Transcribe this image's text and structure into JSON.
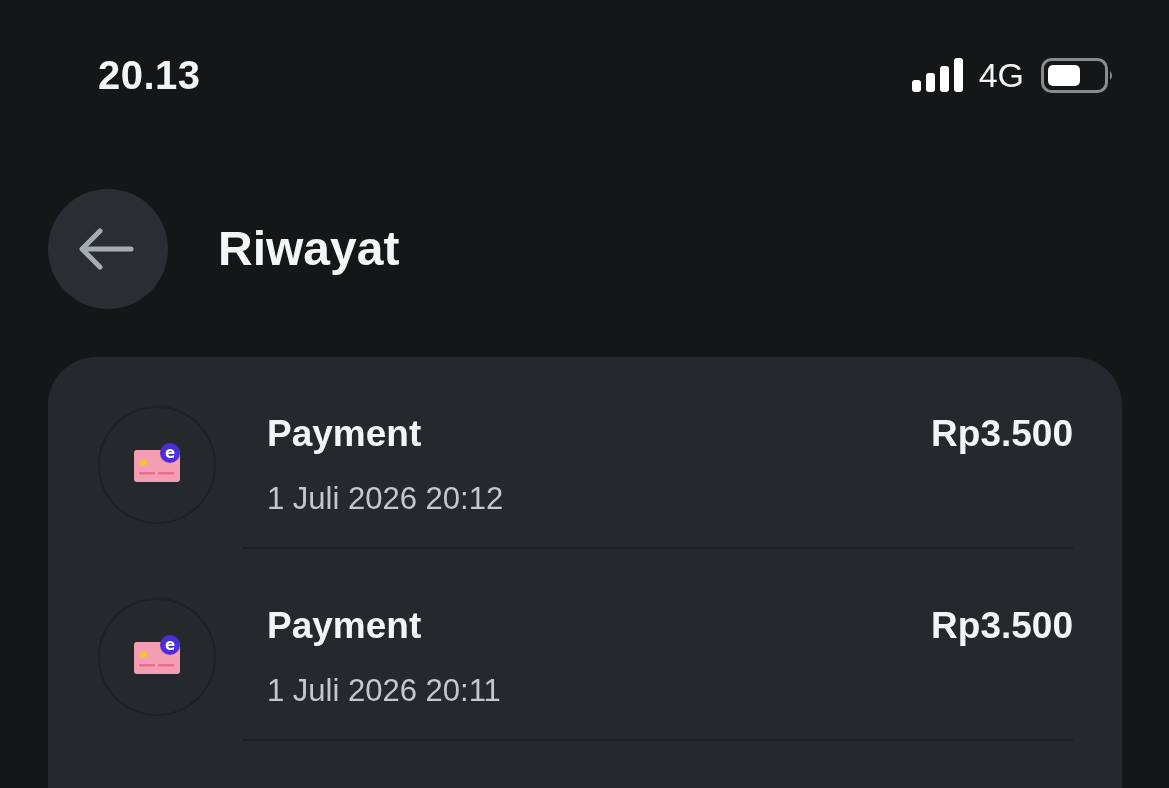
{
  "status_bar": {
    "time": "20.13",
    "network": "4G"
  },
  "header": {
    "title": "Riwayat"
  },
  "transactions": [
    {
      "title": "Payment",
      "amount": "Rp3.500",
      "datetime": "1 Juli 2026 20:12",
      "badge": "e"
    },
    {
      "title": "Payment",
      "amount": "Rp3.500",
      "datetime": "1 Juli 2026 20:11",
      "badge": "e"
    }
  ]
}
